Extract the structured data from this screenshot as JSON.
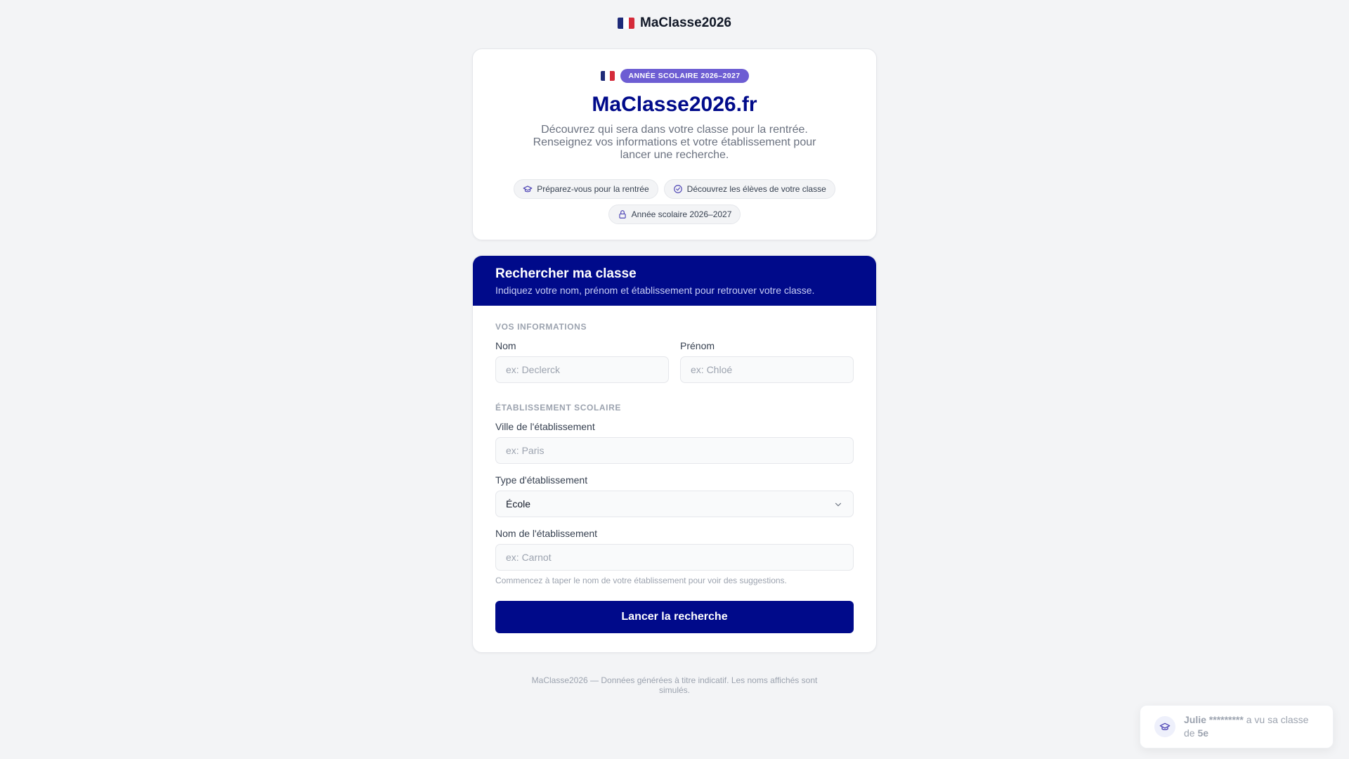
{
  "topbar": {
    "title": "MaClasse2026",
    "flag": "flag-fr-icon"
  },
  "hero": {
    "badge": "ANNÉE SCOLAIRE 2026–2027",
    "title": "MaClasse2026.fr",
    "description": "Découvrez qui sera dans votre classe pour la rentrée. Renseignez vos informations et votre établissement pour lancer une recherche.",
    "pills": [
      {
        "label": "Préparez-vous pour la rentrée",
        "icon": "graduation-cap-icon"
      },
      {
        "label": "Découvrez les élèves de votre classe",
        "icon": "check-circle-icon"
      },
      {
        "label": "Année scolaire 2026–2027",
        "icon": "lock-icon"
      }
    ]
  },
  "form": {
    "title": "Rechercher ma classe",
    "subtitle": "Indiquez votre nom, prénom et établissement pour retrouver votre classe.",
    "section_info": "VOS INFORMATIONS",
    "nom_label": "Nom",
    "nom_placeholder": "ex: Declerck",
    "prenom_label": "Prénom",
    "prenom_placeholder": "ex: Chloé",
    "section_school": "ÉTABLISSEMENT SCOLAIRE",
    "ville_label": "Ville de l'établissement",
    "ville_placeholder": "ex: Paris",
    "type_label": "Type d'établissement",
    "type_value": "École",
    "school_name_label": "Nom de l'établissement",
    "school_name_placeholder": "ex: Carnot",
    "school_hint": "Commencez à taper le nom de votre établissement pour voir des suggestions.",
    "submit_label": "Lancer la recherche"
  },
  "footer": {
    "text": "MaClasse2026 — Données générées à titre indicatif. Les noms affichés sont simulés."
  },
  "toast": {
    "name": "Julie *********",
    "message": " a vu sa classe de ",
    "classe": "5e"
  },
  "colors": {
    "primary": "#000a8a",
    "badge": "#6d5dd3",
    "background": "#f3f4f6"
  }
}
